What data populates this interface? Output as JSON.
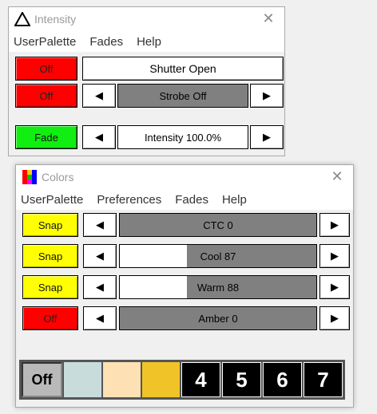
{
  "intensity_window": {
    "title": "Intensity",
    "menu": [
      "UserPalette",
      "Fades",
      "Help"
    ],
    "rows": [
      {
        "button": "Off",
        "button_color": "#ff0000",
        "label": "Shutter Open"
      },
      {
        "button": "Off",
        "button_color": "#ff0000",
        "label": "Strobe Off",
        "level": 0
      },
      {
        "button": "Fade",
        "button_color": "#11ee11",
        "label": "Intensity 100.0%",
        "level": 1.0
      }
    ]
  },
  "colors_window": {
    "title": "Colors",
    "menu": [
      "UserPalette",
      "Preferences",
      "Fades",
      "Help"
    ],
    "rows": [
      {
        "button": "Snap",
        "button_color": "#ffff00",
        "label": "CTC 0",
        "level": 0
      },
      {
        "button": "Snap",
        "button_color": "#ffff00",
        "label": "Cool 87",
        "level": 0.34
      },
      {
        "button": "Snap",
        "button_color": "#ffff00",
        "label": "Warm 88",
        "level": 0.34
      },
      {
        "button": "Off",
        "button_color": "#ff0000",
        "label": "Amber 0",
        "level": 0
      }
    ],
    "palette": [
      {
        "label": "Off",
        "color": "#b9b9b9"
      },
      {
        "label": "",
        "color": "#c8dcdc"
      },
      {
        "label": "",
        "color": "#fde0b4"
      },
      {
        "label": "",
        "color": "#f0c428"
      },
      {
        "label": "4",
        "color": "#000000"
      },
      {
        "label": "5",
        "color": "#000000"
      },
      {
        "label": "6",
        "color": "#000000"
      },
      {
        "label": "7",
        "color": "#000000"
      }
    ]
  },
  "icons": {
    "left_arrow": "◀",
    "right_arrow": "▶",
    "close": "✕"
  }
}
